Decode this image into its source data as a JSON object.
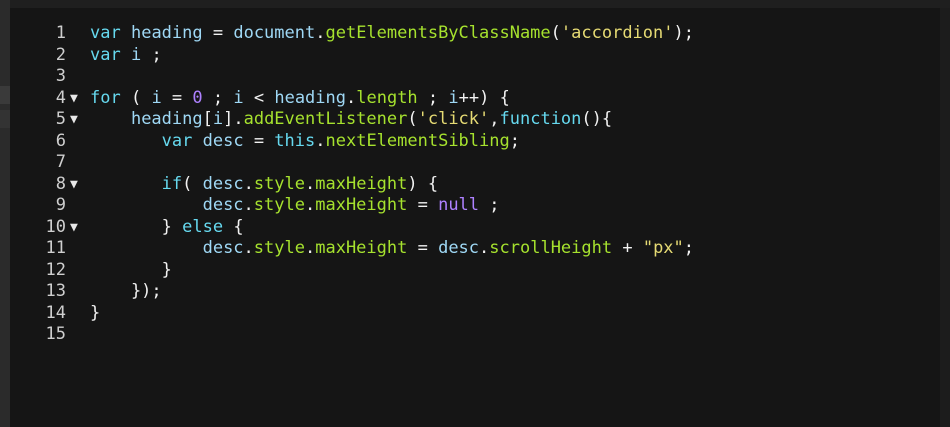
{
  "editor": {
    "lines": [
      {
        "num": "1",
        "fold": "",
        "tokens": [
          [
            "kw",
            "var"
          ],
          [
            "op",
            " "
          ],
          [
            "id",
            "heading"
          ],
          [
            "op",
            " = "
          ],
          [
            "id",
            "document"
          ],
          [
            "op",
            "."
          ],
          [
            "prop",
            "getElementsByClassName"
          ],
          [
            "op",
            "("
          ],
          [
            "str",
            "'accordion'"
          ],
          [
            "op",
            ");"
          ]
        ]
      },
      {
        "num": "2",
        "fold": "",
        "tokens": [
          [
            "kw",
            "var"
          ],
          [
            "op",
            " "
          ],
          [
            "id",
            "i"
          ],
          [
            "op",
            " ;"
          ]
        ]
      },
      {
        "num": "3",
        "fold": "",
        "tokens": []
      },
      {
        "num": "4",
        "fold": "▼",
        "tokens": [
          [
            "kw",
            "for"
          ],
          [
            "op",
            " ( "
          ],
          [
            "id",
            "i"
          ],
          [
            "op",
            " = "
          ],
          [
            "num",
            "0"
          ],
          [
            "op",
            " ; "
          ],
          [
            "id",
            "i"
          ],
          [
            "op",
            " < "
          ],
          [
            "id",
            "heading"
          ],
          [
            "op",
            "."
          ],
          [
            "prop",
            "length"
          ],
          [
            "op",
            " ; "
          ],
          [
            "id",
            "i"
          ],
          [
            "op",
            "++) {"
          ]
        ]
      },
      {
        "num": "5",
        "fold": "▼",
        "tokens": [
          [
            "op",
            "    "
          ],
          [
            "id",
            "heading"
          ],
          [
            "op",
            "["
          ],
          [
            "id",
            "i"
          ],
          [
            "op",
            "]."
          ],
          [
            "prop",
            "addEventListener"
          ],
          [
            "op",
            "("
          ],
          [
            "str",
            "'click'"
          ],
          [
            "op",
            ","
          ],
          [
            "kw",
            "function"
          ],
          [
            "op",
            "(){"
          ]
        ]
      },
      {
        "num": "6",
        "fold": "",
        "tokens": [
          [
            "op",
            "       "
          ],
          [
            "kw",
            "var"
          ],
          [
            "op",
            " "
          ],
          [
            "id",
            "desc"
          ],
          [
            "op",
            " = "
          ],
          [
            "kw",
            "this"
          ],
          [
            "op",
            "."
          ],
          [
            "prop",
            "nextElementSibling"
          ],
          [
            "op",
            ";"
          ]
        ]
      },
      {
        "num": "7",
        "fold": "",
        "tokens": []
      },
      {
        "num": "8",
        "fold": "▼",
        "tokens": [
          [
            "op",
            "       "
          ],
          [
            "kw",
            "if"
          ],
          [
            "op",
            "( "
          ],
          [
            "id",
            "desc"
          ],
          [
            "op",
            "."
          ],
          [
            "prop",
            "style"
          ],
          [
            "op",
            "."
          ],
          [
            "prop",
            "maxHeight"
          ],
          [
            "op",
            ") {"
          ]
        ]
      },
      {
        "num": "9",
        "fold": "",
        "tokens": [
          [
            "op",
            "           "
          ],
          [
            "id",
            "desc"
          ],
          [
            "op",
            "."
          ],
          [
            "prop",
            "style"
          ],
          [
            "op",
            "."
          ],
          [
            "prop",
            "maxHeight"
          ],
          [
            "op",
            " = "
          ],
          [
            "nul",
            "null"
          ],
          [
            "op",
            " ;"
          ]
        ]
      },
      {
        "num": "10",
        "fold": "▼",
        "tokens": [
          [
            "op",
            "       "
          ],
          [
            "op",
            "} "
          ],
          [
            "kw",
            "else"
          ],
          [
            "op",
            " {"
          ]
        ]
      },
      {
        "num": "11",
        "fold": "",
        "tokens": [
          [
            "op",
            "           "
          ],
          [
            "id",
            "desc"
          ],
          [
            "op",
            "."
          ],
          [
            "prop",
            "style"
          ],
          [
            "op",
            "."
          ],
          [
            "prop",
            "maxHeight"
          ],
          [
            "op",
            " = "
          ],
          [
            "id",
            "desc"
          ],
          [
            "op",
            "."
          ],
          [
            "prop",
            "scrollHeight"
          ],
          [
            "op",
            " + "
          ],
          [
            "str",
            "\"px\""
          ],
          [
            "op",
            ";"
          ]
        ]
      },
      {
        "num": "12",
        "fold": "",
        "tokens": [
          [
            "op",
            "       }"
          ]
        ]
      },
      {
        "num": "13",
        "fold": "",
        "tokens": [
          [
            "op",
            "    });"
          ]
        ]
      },
      {
        "num": "14",
        "fold": "",
        "tokens": [
          [
            "op",
            "}"
          ]
        ]
      },
      {
        "num": "15",
        "fold": "",
        "tokens": []
      }
    ]
  }
}
